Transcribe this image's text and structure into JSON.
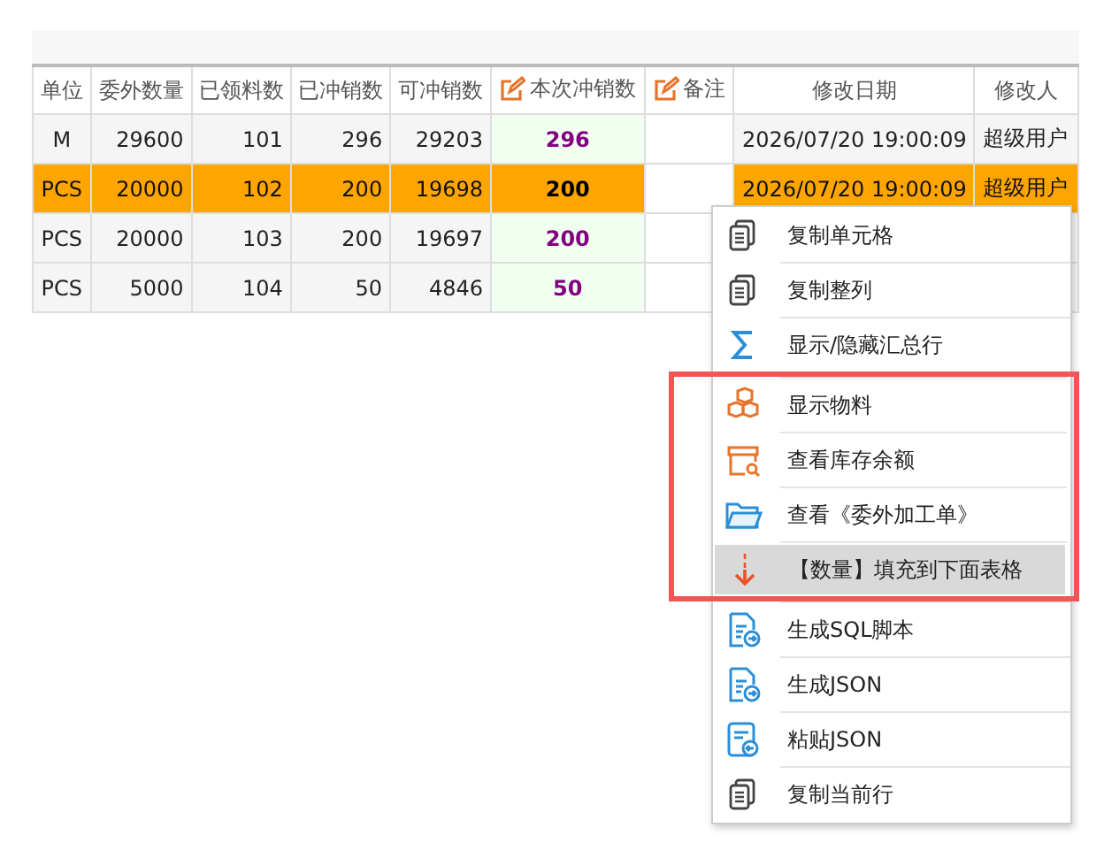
{
  "table": {
    "columns": [
      {
        "label": "单位",
        "kind": "text",
        "editable": false
      },
      {
        "label": "委外数量",
        "kind": "number",
        "editable": false
      },
      {
        "label": "已领料数",
        "kind": "number",
        "editable": false
      },
      {
        "label": "已冲销数",
        "kind": "number",
        "editable": false
      },
      {
        "label": "可冲销数",
        "kind": "number",
        "editable": false
      },
      {
        "label": "本次冲销数",
        "kind": "amount",
        "editable": true
      },
      {
        "label": "备注",
        "kind": "note",
        "editable": true
      },
      {
        "label": "修改日期",
        "kind": "text",
        "editable": false
      },
      {
        "label": "修改人",
        "kind": "text",
        "editable": false
      }
    ],
    "rows": [
      {
        "selected": false,
        "cells": [
          "M",
          "29600",
          "101",
          "296",
          "29203",
          "296",
          "",
          "2026/07/20 19:00:09",
          "超级用户"
        ]
      },
      {
        "selected": true,
        "cells": [
          "PCS",
          "20000",
          "102",
          "200",
          "19698",
          "200",
          "",
          "2026/07/20 19:00:09",
          "超级用户"
        ]
      },
      {
        "selected": false,
        "cells": [
          "PCS",
          "20000",
          "103",
          "200",
          "19697",
          "200",
          ""
        ]
      },
      {
        "selected": false,
        "cells": [
          "PCS",
          "5000",
          "104",
          "50",
          "4846",
          "50",
          ""
        ]
      }
    ]
  },
  "context_menu": {
    "items": [
      {
        "label": "复制单元格",
        "kind": "copy",
        "selected": false,
        "highlighted": false
      },
      {
        "label": "复制整列",
        "kind": "copy",
        "selected": false,
        "highlighted": false
      },
      {
        "label": "显示/隐藏汇总行",
        "kind": "sum",
        "selected": false,
        "highlighted": false
      },
      {
        "label": "显示物料",
        "kind": "boxes",
        "selected": false,
        "highlighted": true
      },
      {
        "label": "查看库存余额",
        "kind": "stock",
        "selected": false,
        "highlighted": true
      },
      {
        "label": "查看《委外加工单》",
        "kind": "folder",
        "selected": false,
        "highlighted": true
      },
      {
        "label": "【数量】填充到下面表格",
        "kind": "fill-down",
        "selected": true,
        "highlighted": true
      },
      {
        "label": "生成SQL脚本",
        "kind": "export",
        "selected": false,
        "highlighted": false
      },
      {
        "label": "生成JSON",
        "kind": "export",
        "selected": false,
        "highlighted": false
      },
      {
        "label": "粘贴JSON",
        "kind": "paste",
        "selected": false,
        "highlighted": false
      },
      {
        "label": "复制当前行",
        "kind": "copy",
        "selected": false,
        "highlighted": false
      }
    ]
  }
}
